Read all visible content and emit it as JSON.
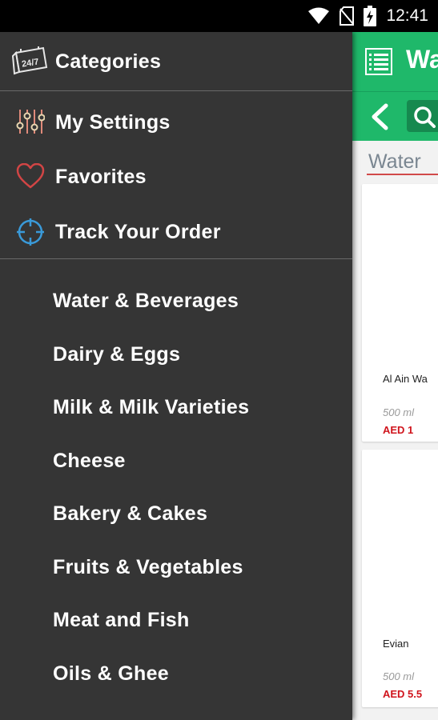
{
  "status_bar": {
    "time": "12:41",
    "icons": [
      "wifi-icon",
      "no-sim-icon",
      "battery-charging-icon"
    ]
  },
  "drawer": {
    "header": {
      "label": "Categories",
      "icon": "24-7-icon"
    },
    "nav_items": [
      {
        "label": "My Settings",
        "icon": "sliders-icon"
      },
      {
        "label": "Favorites",
        "icon": "heart-icon"
      },
      {
        "label": "Track Your Order",
        "icon": "crosshair-icon"
      }
    ],
    "categories": [
      "Water & Beverages",
      "Dairy & Eggs",
      "Milk & Milk Varieties",
      "Cheese",
      "Bakery & Cakes",
      "Fruits & Vegetables",
      "Meat and Fish",
      "Oils & Ghee"
    ]
  },
  "app": {
    "header_title": "Wa",
    "tab_title": "Water",
    "colors": {
      "primary": "#1fb86a",
      "drawer_bg": "#353535",
      "price": "#d0141c"
    },
    "products": [
      {
        "name": "Al Ain Wa",
        "size": "500 ml",
        "price": "AED 1"
      },
      {
        "name": "Evian",
        "size": "500 ml",
        "price": "AED 5.5"
      }
    ]
  }
}
